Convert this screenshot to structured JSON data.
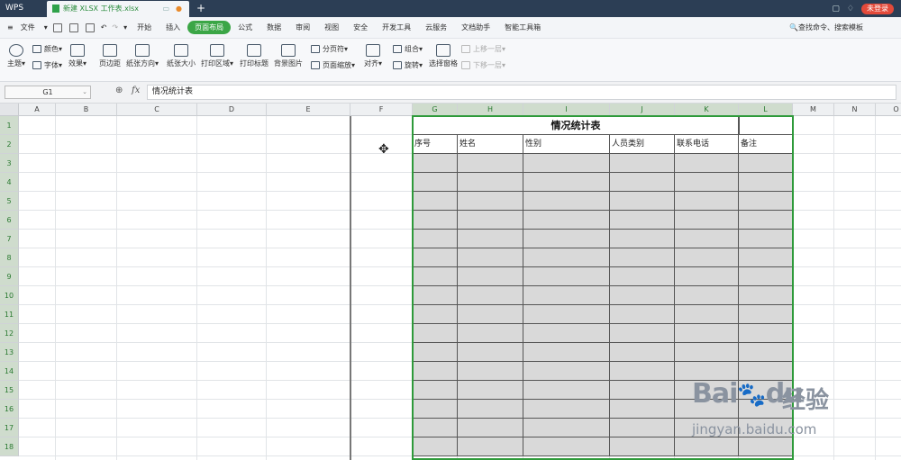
{
  "titlebar": {
    "app_name": "WPS",
    "doc_tab": "新建 XLSX 工作表.xlsx",
    "new_tab": "+",
    "login": "未登录"
  },
  "menubar": {
    "file": "文件",
    "items": [
      "开始",
      "插入",
      "页面布局",
      "公式",
      "数据",
      "审阅",
      "视图",
      "安全",
      "开发工具",
      "云服务",
      "文档助手",
      "智能工具箱"
    ],
    "active": "页面布局",
    "search": "查找命令、搜索模板"
  },
  "ribbon": {
    "theme": "主题",
    "colors": "颜色",
    "fonts": "字体",
    "effects": "效果",
    "margins": "页边距",
    "orientation": "纸张方向",
    "size": "纸张大小",
    "print_area": "打印区域",
    "print_titles": "打印标题",
    "background": "背景图片",
    "page_break": "分页符",
    "page_zoom": "页面缩放",
    "align": "对齐",
    "group": "组合",
    "rotate": "旋转",
    "selection_pane": "选择窗格",
    "bring_forward": "上移一层",
    "send_backward": "下移一层"
  },
  "formula": {
    "name_box": "G1",
    "fx": "fx",
    "content": "情况统计表"
  },
  "grid": {
    "columns": [
      "A",
      "B",
      "C",
      "D",
      "E",
      "F",
      "G",
      "H",
      "I",
      "J",
      "K",
      "L",
      "M",
      "N",
      "O"
    ],
    "selected_columns": [
      "G",
      "H",
      "I",
      "J",
      "K",
      "L"
    ],
    "rows": [
      "1",
      "2",
      "3",
      "4",
      "5",
      "6",
      "7",
      "8",
      "9",
      "10",
      "11",
      "12",
      "13",
      "14",
      "15",
      "16",
      "17",
      "18"
    ],
    "table_title": "情况统计表",
    "headers": [
      "序号",
      "姓名",
      "性别",
      "人员类别",
      "联系电话",
      "备注"
    ]
  },
  "watermark": {
    "brand": "Bai",
    "brand_suffix": "du",
    "cn": "经验",
    "url": "jingyan.baidu.com"
  }
}
